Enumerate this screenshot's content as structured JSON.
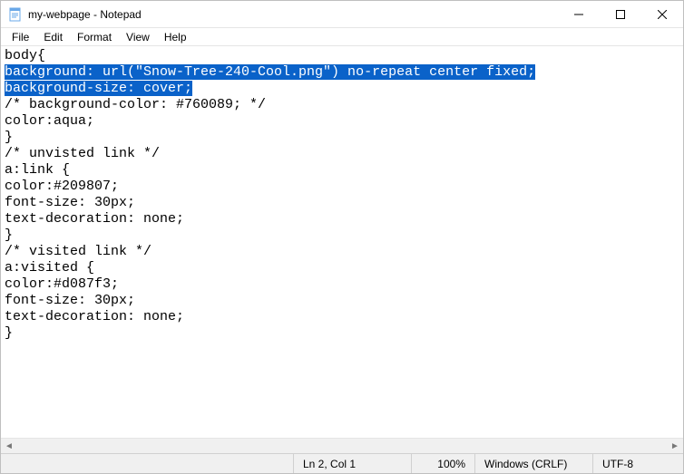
{
  "window": {
    "title": "my-webpage - Notepad"
  },
  "menu": {
    "file": "File",
    "edit": "Edit",
    "format": "Format",
    "view": "View",
    "help": "Help"
  },
  "content": {
    "lines": [
      {
        "text": "body{",
        "selected": false
      },
      {
        "text": "background: url(\"Snow-Tree-240-Cool.png\") no-repeat center fixed;",
        "selected": true
      },
      {
        "text": "background-size: cover;",
        "selected": true
      },
      {
        "text": "/* background-color: #760089; */",
        "selected": false
      },
      {
        "text": "color:aqua;",
        "selected": false
      },
      {
        "text": "}",
        "selected": false
      },
      {
        "text": "/* unvisted link */",
        "selected": false
      },
      {
        "text": "a:link {",
        "selected": false
      },
      {
        "text": "color:#209807;",
        "selected": false
      },
      {
        "text": "font-size: 30px;",
        "selected": false
      },
      {
        "text": "text-decoration: none;",
        "selected": false
      },
      {
        "text": "}",
        "selected": false
      },
      {
        "text": "/* visited link */",
        "selected": false
      },
      {
        "text": "a:visited {",
        "selected": false
      },
      {
        "text": "color:#d087f3;",
        "selected": false
      },
      {
        "text": "font-size: 30px;",
        "selected": false
      },
      {
        "text": "text-decoration: none;",
        "selected": false
      },
      {
        "text": "}",
        "selected": false
      }
    ]
  },
  "status": {
    "position": "Ln 2, Col 1",
    "zoom": "100%",
    "line_ending": "Windows (CRLF)",
    "encoding": "UTF-8"
  }
}
